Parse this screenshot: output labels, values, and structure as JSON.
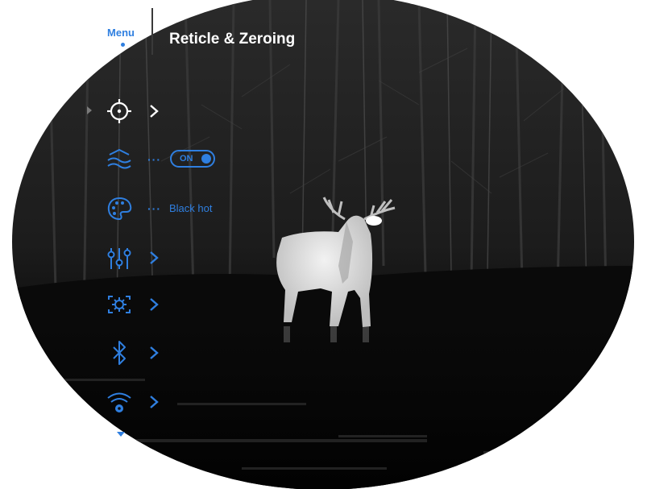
{
  "header": {
    "menu_label": "Menu",
    "title": "Reticle & Zeroing"
  },
  "menu": {
    "items": [
      {
        "icon": "reticle-crosshair-icon",
        "selected": true,
        "has_submenu": true
      },
      {
        "icon": "image-smoothing-waves-icon",
        "value": "ON",
        "control": "toggle"
      },
      {
        "icon": "color-palette-icon",
        "value": "Black hot"
      },
      {
        "icon": "sliders-settings-icon",
        "has_submenu": true
      },
      {
        "icon": "camera-gear-settings-icon",
        "has_submenu": true
      },
      {
        "icon": "bluetooth-icon",
        "has_submenu": true
      },
      {
        "icon": "wifi-settings-icon",
        "has_submenu": true
      }
    ],
    "more_indicator": "···"
  },
  "colors": {
    "accent": "#2f7fe0",
    "title": "#ffffff",
    "background": "#0b0b0b",
    "outside": "#ffffff"
  }
}
